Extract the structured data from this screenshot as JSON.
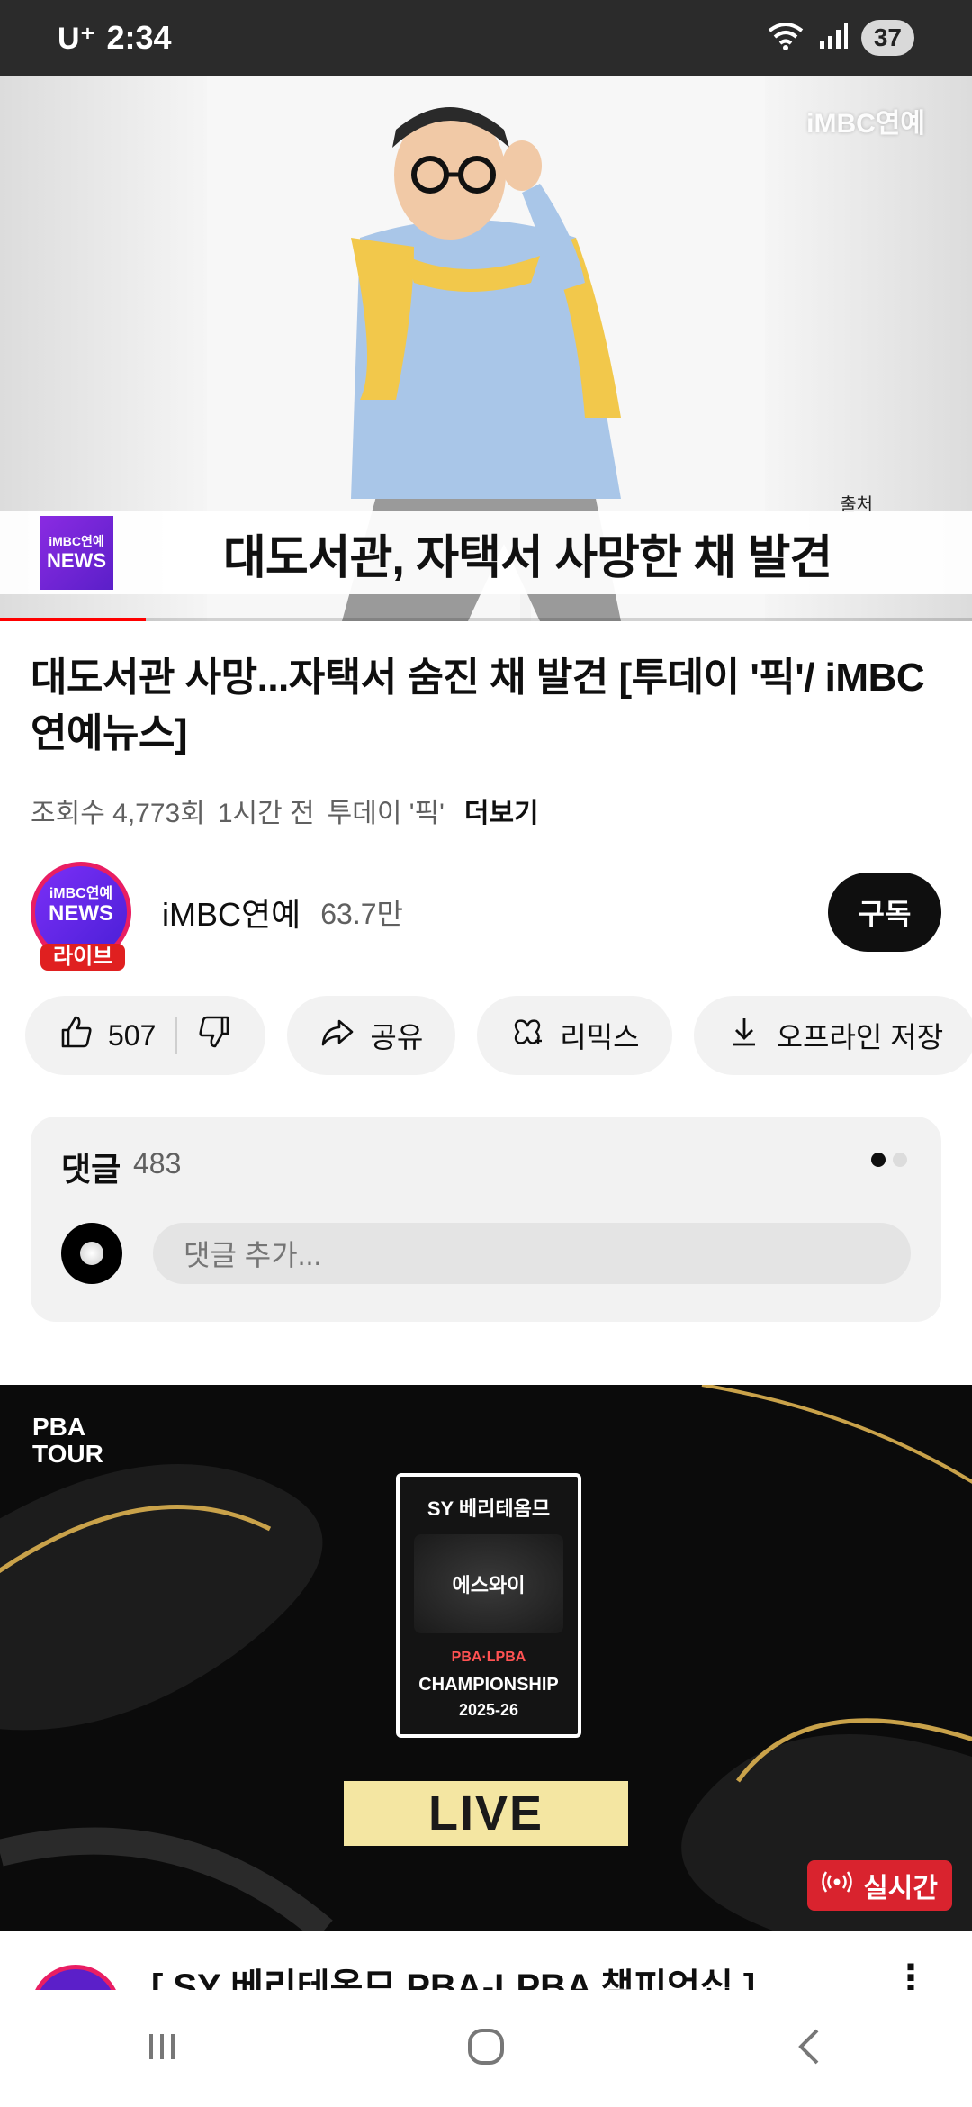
{
  "status_bar": {
    "carrier": "U⁺",
    "time": "2:34",
    "battery": "37"
  },
  "video": {
    "watermark": "iMBC연예",
    "source_label": "출처",
    "news_logo_top": "iMBC연예",
    "news_logo_bottom": "NEWS",
    "headline": "대도서관, 자택서 사망한 채 발견",
    "progress_fraction": 0.15
  },
  "details": {
    "title": "대도서관 사망...자택서 숨진 채 발견 [투데이 '픽'/ iMBC연예뉴스]",
    "views": "조회수 4,773회",
    "time_ago": "1시간 전",
    "tag": "투데이 '픽'",
    "more": "더보기"
  },
  "channel": {
    "avatar_top": "iMBC연예",
    "avatar_bottom": "NEWS",
    "live_badge": "라이브",
    "name": "iMBC연예",
    "subscribers": "63.7만",
    "subscribe_label": "구독"
  },
  "actions": {
    "likes": "507",
    "share": "공유",
    "remix": "리믹스",
    "download": "오프라인 저장"
  },
  "comments": {
    "title": "댓글",
    "count": "483",
    "placeholder": "댓글 추가..."
  },
  "live_video": {
    "logo_top": "PBA",
    "logo_bottom": "TOUR",
    "card_title": "SY 베리테옴므",
    "emblem_text": "에스와이",
    "card_league": "PBA·LPBA",
    "card_championship": "CHAMPIONSHIP",
    "card_season": "2025-26",
    "live_label": "LIVE",
    "realtime_label": "실시간"
  },
  "next_item": {
    "title": "[ SY 베리테옴므 PBA-LPBA 챔피언십 ]"
  },
  "colors": {
    "accent_red": "#ff0000",
    "subscribe_bg": "#0f0f0f",
    "realtime_bg": "#d9232e",
    "live_box_bg": "#f4e6a2"
  }
}
